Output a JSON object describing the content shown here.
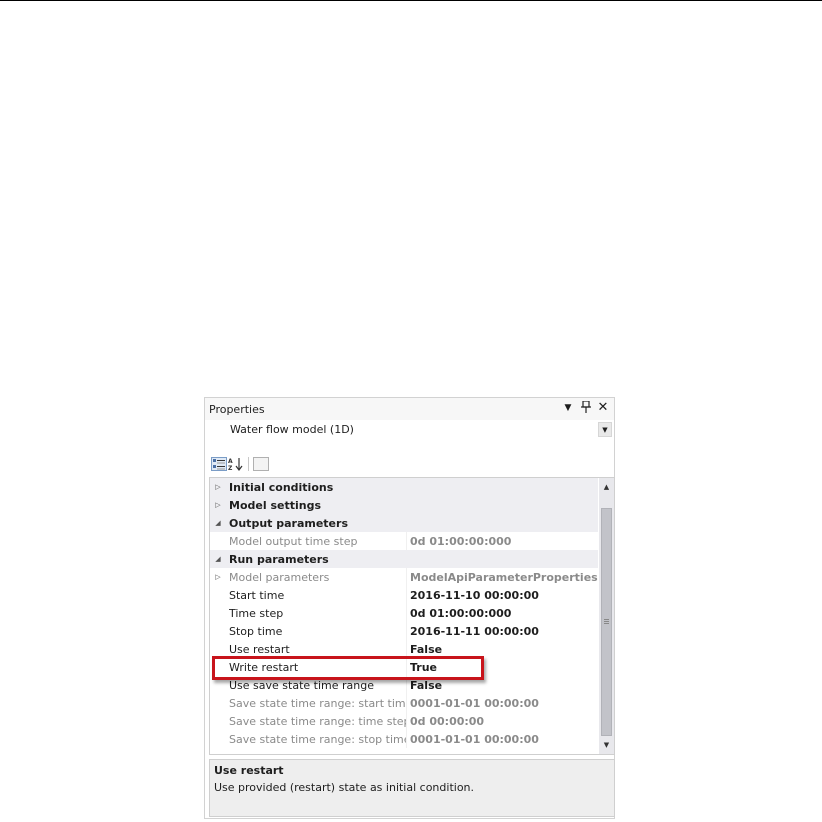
{
  "panel": {
    "title": "Properties",
    "title_icons": [
      "dropdown-arrow-icon",
      "pin-icon",
      "close-icon"
    ],
    "selected_object": "Water flow model (1D)"
  },
  "toolbar": {
    "buttons": [
      "categorized-view-icon",
      "alphabetical-sort-icon",
      "property-pages-icon"
    ]
  },
  "grid": {
    "rows": [
      {
        "type": "category",
        "glyph": "collapsed",
        "name": "Initial conditions"
      },
      {
        "type": "category",
        "glyph": "collapsed",
        "name": "Model settings"
      },
      {
        "type": "category",
        "glyph": "expanded",
        "name": "Output parameters"
      },
      {
        "type": "property",
        "readonly": true,
        "name": "Model output time step",
        "value": "0d 01:00:00:000"
      },
      {
        "type": "category",
        "glyph": "expanded",
        "name": "Run parameters"
      },
      {
        "type": "property",
        "readonly": true,
        "glyph": "collapsed",
        "name": "Model parameters",
        "value": "ModelApiParameterProperties[] A"
      },
      {
        "type": "property",
        "readonly": false,
        "name": "Start time",
        "value": "2016-11-10 00:00:00"
      },
      {
        "type": "property",
        "readonly": false,
        "name": "Time step",
        "value": "0d 01:00:00:000"
      },
      {
        "type": "property",
        "readonly": false,
        "name": "Stop time",
        "value": "2016-11-11 00:00:00"
      },
      {
        "type": "property",
        "readonly": false,
        "name": "Use restart",
        "value": "False"
      },
      {
        "type": "property",
        "readonly": false,
        "name": "Write restart",
        "value": "True",
        "highlighted": true
      },
      {
        "type": "property",
        "readonly": false,
        "name": "Use save state time range",
        "value": "False"
      },
      {
        "type": "property",
        "readonly": true,
        "name": "Save state time range: start time",
        "value": "0001-01-01 00:00:00"
      },
      {
        "type": "property",
        "readonly": true,
        "name": "Save state time range: time step in",
        "value": "0d 00:00:00"
      },
      {
        "type": "property",
        "readonly": true,
        "name": "Save state time range: stop time",
        "value": "0001-01-01 00:00:00"
      }
    ]
  },
  "description": {
    "title": "Use restart",
    "text": "Use provided (restart) state as initial condition."
  },
  "colors": {
    "highlight_border": "#c8141b",
    "category_row_bg": "#eeeef2",
    "readonly_text": "#8a8a8a"
  }
}
